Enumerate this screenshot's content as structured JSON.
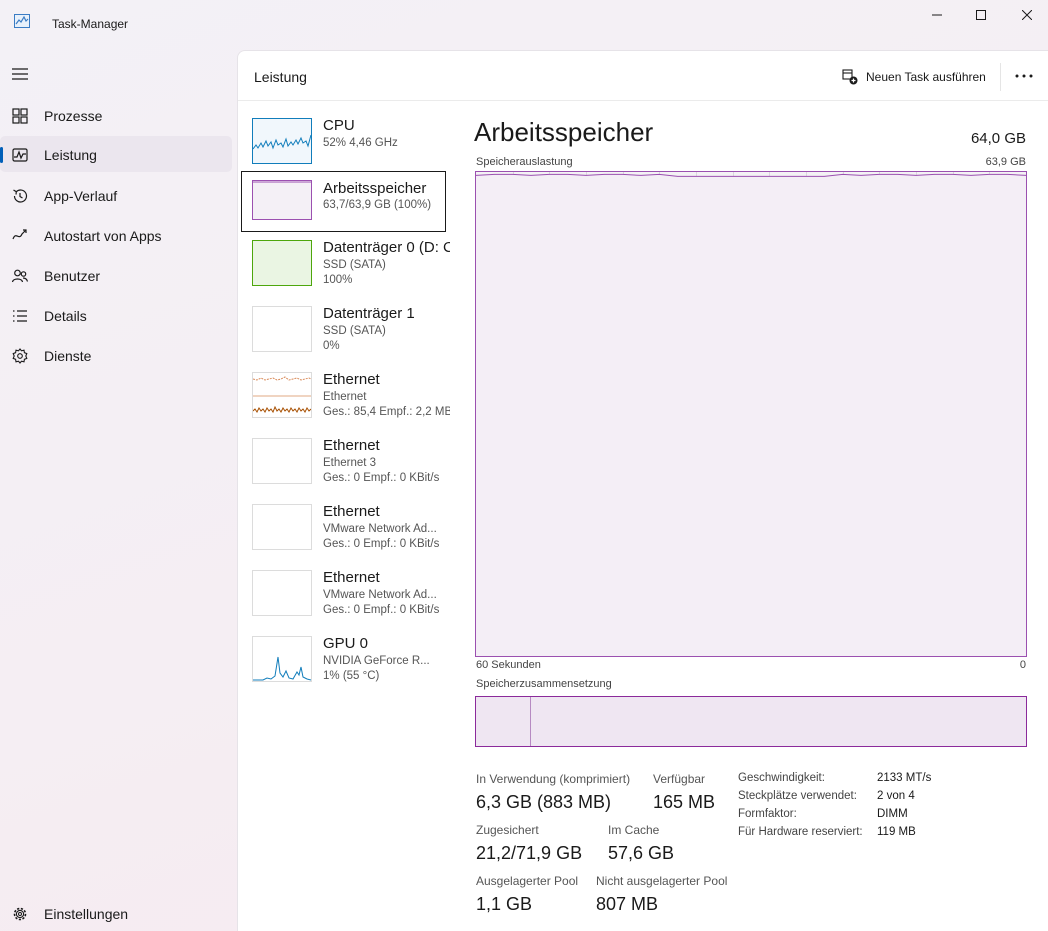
{
  "window": {
    "title": "Task-Manager"
  },
  "sidebar": {
    "items": [
      {
        "label": "Prozesse",
        "icon": "processes-icon"
      },
      {
        "label": "Leistung",
        "icon": "performance-icon",
        "active": true
      },
      {
        "label": "App-Verlauf",
        "icon": "history-icon"
      },
      {
        "label": "Autostart von Apps",
        "icon": "startup-icon"
      },
      {
        "label": "Benutzer",
        "icon": "users-icon"
      },
      {
        "label": "Details",
        "icon": "details-icon"
      },
      {
        "label": "Dienste",
        "icon": "services-icon"
      }
    ],
    "settings_label": "Einstellungen"
  },
  "header": {
    "title": "Leistung",
    "new_task_label": "Neuen Task ausführen"
  },
  "devices": [
    {
      "name": "CPU",
      "sub1": "52%  4,46 GHz",
      "sub2": ""
    },
    {
      "name": "Arbeitsspeicher",
      "sub1": "63,7/63,9 GB (100%)",
      "sub2": ""
    },
    {
      "name": "Datenträger 0 (D: C",
      "sub1": "SSD (SATA)",
      "sub2": "100%"
    },
    {
      "name": "Datenträger 1",
      "sub1": "SSD (SATA)",
      "sub2": "0%"
    },
    {
      "name": "Ethernet",
      "sub1": "Ethernet",
      "sub2": "Ges.: 85,4 Empf.: 2,2 MB"
    },
    {
      "name": "Ethernet",
      "sub1": "Ethernet 3",
      "sub2": "Ges.: 0 Empf.: 0 KBit/s"
    },
    {
      "name": "Ethernet",
      "sub1": "VMware Network Ad...",
      "sub2": "Ges.: 0 Empf.: 0 KBit/s"
    },
    {
      "name": "Ethernet",
      "sub1": "VMware Network Ad...",
      "sub2": "Ges.: 0 Empf.: 0 KBit/s"
    },
    {
      "name": "GPU 0",
      "sub1": "NVIDIA GeForce R...",
      "sub2": "1%  (55 °C)"
    }
  ],
  "detail": {
    "title": "Arbeitsspeicher",
    "total": "64,0 GB",
    "usage_label": "Speicherauslastung",
    "usage_max": "63,9 GB",
    "time_left": "60 Sekunden",
    "time_right": "0",
    "composition_label": "Speicherzusammensetzung",
    "composition_in_use_fraction": 0.1,
    "usage_level_fraction": 0.995,
    "stats": {
      "in_use_label": "In Verwendung (komprimiert)",
      "in_use_value": "6,3 GB (883 MB)",
      "available_label": "Verfügbar",
      "available_value": "165 MB",
      "committed_label": "Zugesichert",
      "committed_value": "21,2/71,9 GB",
      "cached_label": "Im Cache",
      "cached_value": "57,6 GB",
      "paged_label": "Ausgelagerter Pool",
      "paged_value": "1,1 GB",
      "nonpaged_label": "Nicht ausgelagerter Pool",
      "nonpaged_value": "807 MB"
    },
    "info": {
      "speed_label": "Geschwindigkeit:",
      "speed_value": "2133 MT/s",
      "slots_label": "Steckplätze verwendet:",
      "slots_value": "2 von 4",
      "form_label": "Formfaktor:",
      "form_value": "DIMM",
      "reserved_label": "Für Hardware reserviert:",
      "reserved_value": "119 MB"
    }
  },
  "colors": {
    "memory": "#9b50b0",
    "cpu": "#117dbb",
    "disk": "#4da60c",
    "ethernet": "#a74f01",
    "accent": "#005fb8"
  }
}
